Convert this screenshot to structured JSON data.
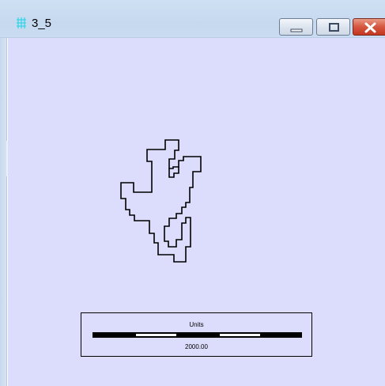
{
  "window": {
    "title": "3_5",
    "icon": "grid-map-icon",
    "buttons": [
      "minimize",
      "maximize",
      "close"
    ],
    "colors": {
      "canvas": "#dcdcfc",
      "close_button": "#d5563f",
      "outline": "#000000"
    }
  },
  "scale_bar": {
    "units_label": "Units",
    "distance_label": "2000.00"
  }
}
